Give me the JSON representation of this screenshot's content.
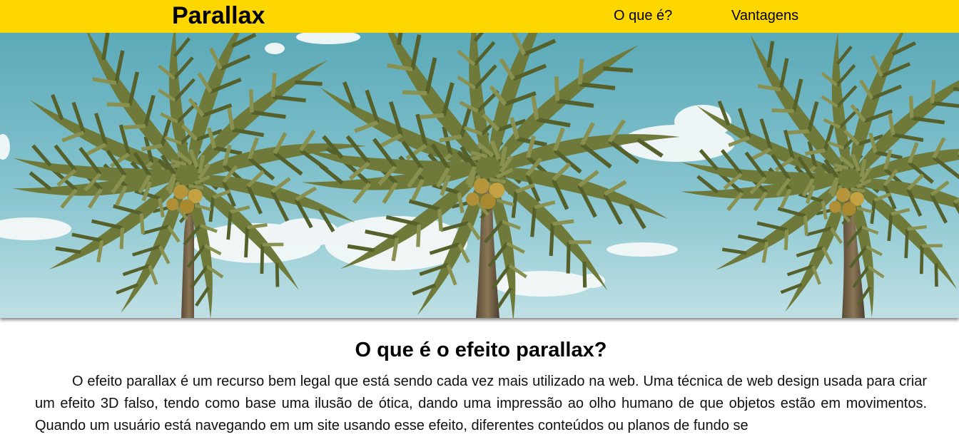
{
  "header": {
    "logo": "Parallax",
    "nav": [
      {
        "label": "O que é?"
      },
      {
        "label": "Vantagens"
      }
    ],
    "background_color": "#FFD700"
  },
  "hero": {
    "image": "palm-trees-sky-photo"
  },
  "section": {
    "title": "O que é o efeito parallax?",
    "paragraph": "O efeito parallax é um recurso bem legal que está sendo cada vez mais utilizado na web. Uma técnica de web design usada para criar um efeito 3D falso, tendo como base uma ilusão de ótica, dando uma impressão ao olho humano de que objetos estão em movimentos. Quando um usuário está navegando em um site usando esse efeito, diferentes conteúdos ou planos de fundo se"
  }
}
